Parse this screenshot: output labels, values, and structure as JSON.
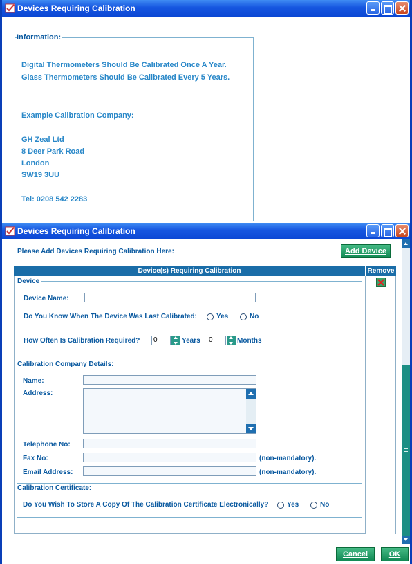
{
  "window1": {
    "title": "Devices Requiring Calibration",
    "info_group_title": "Information:",
    "info_lines": [
      "Digital Thermometers Should Be Calibrated Once A Year.",
      "Glass Thermometers Should Be Calibrated Every 5 Years.",
      "Example Calibration Company:",
      "GH Zeal Ltd",
      "8 Deer Park Road",
      "London",
      "SW19 3UU",
      "Tel: 0208 542 2283"
    ]
  },
  "window2": {
    "title": "Devices Requiring Calibration",
    "prompt": "Please Add Devices Requiring Calibration Here:",
    "add_device_button": "Add Device",
    "table_header": "Device(s) Requiring Calibration",
    "remove_header": "Remove",
    "device_group": {
      "title": "Device",
      "device_name_label": "Device Name:",
      "device_name_value": "",
      "last_calibrated_question": "Do You Know When The Device Was Last Calibrated:",
      "yes_label": "Yes",
      "no_label": "No",
      "frequency_label": "How Often Is Calibration Required?",
      "years_value": "0",
      "years_label": "Years",
      "months_value": "0",
      "months_label": "Months"
    },
    "company_group": {
      "title": "Calibration Company Details:",
      "name_label": "Name:",
      "address_label": "Address:",
      "telephone_label": "Telephone No:",
      "fax_label": "Fax No:",
      "email_label": "Email Address:",
      "non_mandatory_fax": "(non-mandatory).",
      "non_mandatory_email": "(non-mandatory)."
    },
    "certificate_group": {
      "title": "Calibration Certificate:",
      "question": "Do You Wish To Store A Copy Of The Calibration Certificate Electronically?",
      "yes_label": "Yes",
      "no_label": "No"
    },
    "cancel_button": "Cancel",
    "ok_button": "OK"
  },
  "colors": {
    "titlebar": "#1656e0",
    "label_text": "#0b5aa0",
    "info_text": "#2887c8",
    "button_green": "#128a55",
    "header_blue": "#1a6da8",
    "scrollbar_teal": "#1c8e84"
  }
}
